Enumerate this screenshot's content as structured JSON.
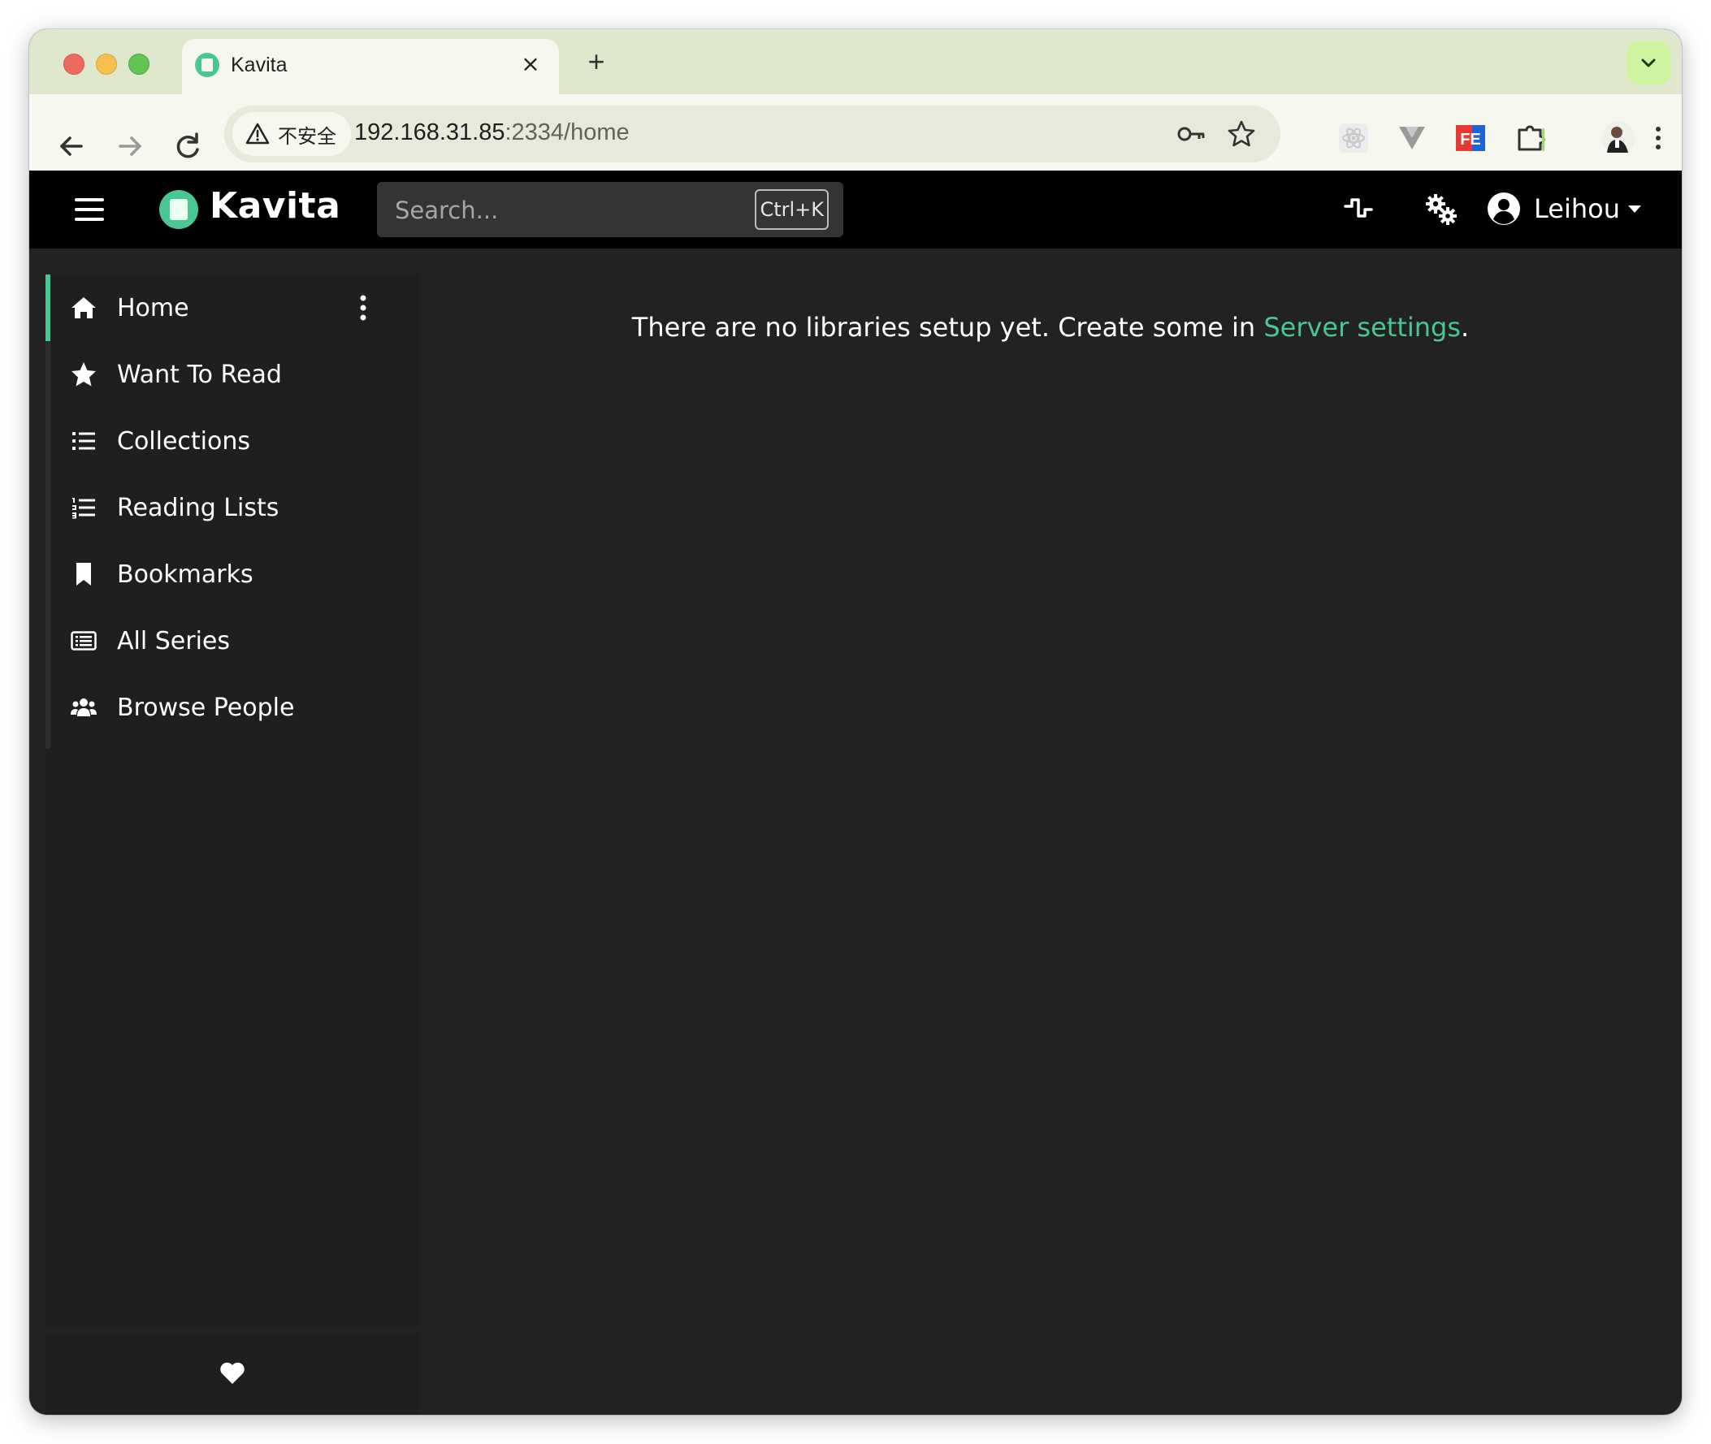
{
  "browser": {
    "tab_title": "Kavita",
    "close_symbol": "×",
    "new_tab_symbol": "+",
    "security_label": "不安全",
    "url_host": "192.168.31.85",
    "url_rest": ":2334/home"
  },
  "app": {
    "logo_text": "Kavita",
    "search_placeholder": "Search...",
    "search_shortcut": "Ctrl+K",
    "user_name": "Leihou",
    "accent_color": "#4ac694"
  },
  "sidebar": {
    "items": [
      {
        "label": "Home",
        "icon": "home-icon",
        "active": true
      },
      {
        "label": "Want To Read",
        "icon": "star-icon"
      },
      {
        "label": "Collections",
        "icon": "list-icon"
      },
      {
        "label": "Reading Lists",
        "icon": "numbered-list-icon"
      },
      {
        "label": "Bookmarks",
        "icon": "bookmark-icon"
      },
      {
        "label": "All Series",
        "icon": "rectangle-list-icon"
      },
      {
        "label": "Browse People",
        "icon": "users-icon"
      }
    ],
    "footer_icon": "heart-icon"
  },
  "main": {
    "message_prefix": "There are no libraries setup yet. Create some in ",
    "message_link": "Server settings",
    "message_suffix": "."
  }
}
